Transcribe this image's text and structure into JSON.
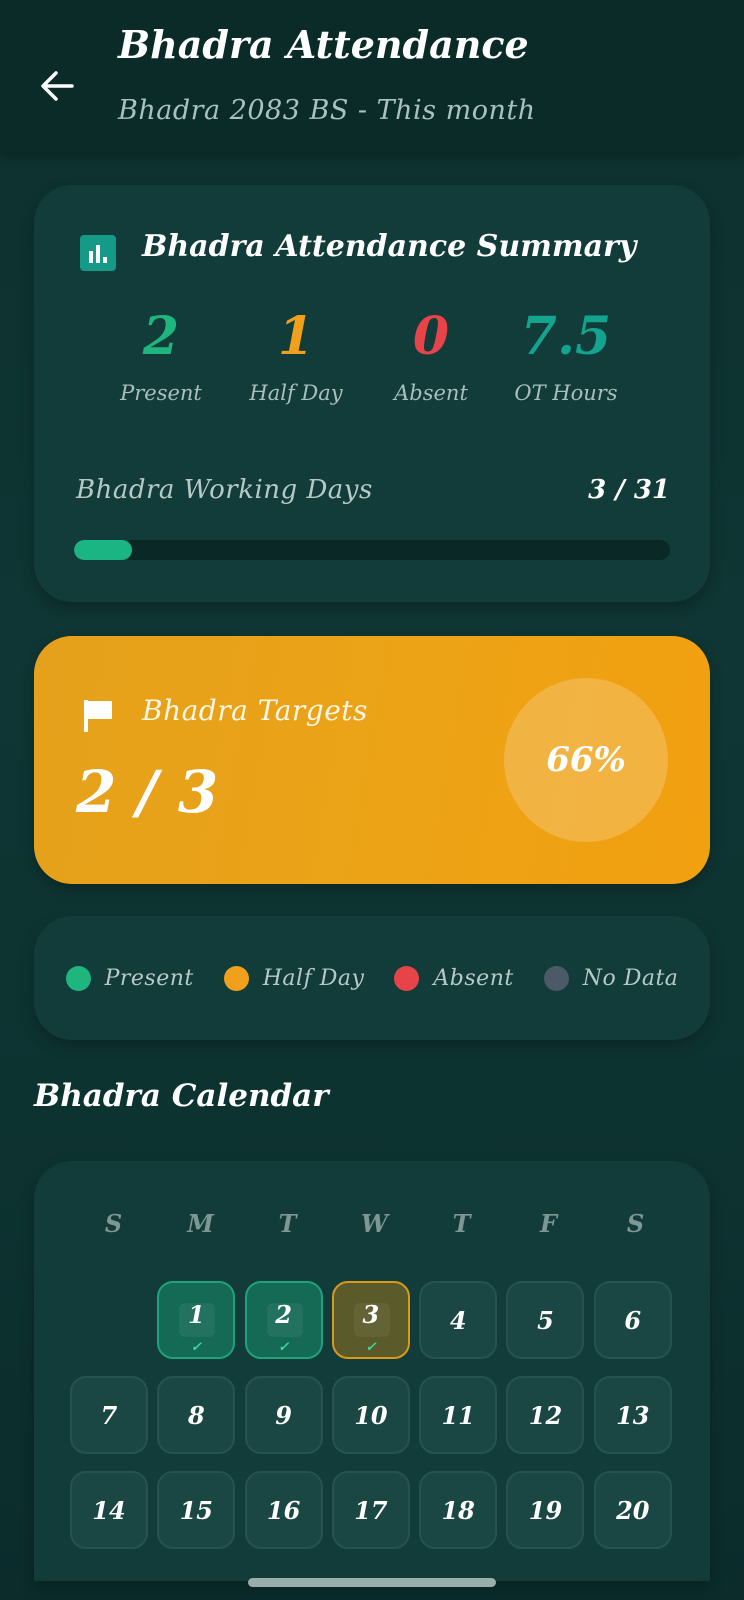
{
  "header": {
    "title": "Bhadra Attendance",
    "subtitle": "Bhadra 2083 BS - This month"
  },
  "summary": {
    "title": "Bhadra Attendance Summary",
    "stats": [
      {
        "value": "2",
        "label": "Present",
        "color": "#1fb57f"
      },
      {
        "value": "1",
        "label": "Half Day",
        "color": "#f0a01a"
      },
      {
        "value": "0",
        "label": "Absent",
        "color": "#e9434a"
      },
      {
        "value": "7.5",
        "label": "OT Hours",
        "color": "#14a38f"
      }
    ],
    "working_days_label": "Bhadra Working Days",
    "working_days_value": "3 / 31",
    "progress_fraction": 0.0968
  },
  "targets": {
    "title": "Bhadra Targets",
    "value": "2 / 3",
    "percent": "66%"
  },
  "legend": [
    {
      "label": "Present",
      "color": "#1fb57f"
    },
    {
      "label": "Half Day",
      "color": "#f0a01a"
    },
    {
      "label": "Absent",
      "color": "#e9434a"
    },
    {
      "label": "No Data",
      "color": "#4b5a66"
    }
  ],
  "calendar": {
    "title": "Bhadra Calendar",
    "weekdays": [
      "S",
      "M",
      "T",
      "W",
      "T",
      "F",
      "S"
    ],
    "days": [
      {
        "n": "",
        "status": "empty"
      },
      {
        "n": "1",
        "status": "present"
      },
      {
        "n": "2",
        "status": "present"
      },
      {
        "n": "3",
        "status": "half"
      },
      {
        "n": "4",
        "status": "none"
      },
      {
        "n": "5",
        "status": "none"
      },
      {
        "n": "6",
        "status": "none"
      },
      {
        "n": "7",
        "status": "none"
      },
      {
        "n": "8",
        "status": "none"
      },
      {
        "n": "9",
        "status": "none"
      },
      {
        "n": "10",
        "status": "none"
      },
      {
        "n": "11",
        "status": "none"
      },
      {
        "n": "12",
        "status": "none"
      },
      {
        "n": "13",
        "status": "none"
      },
      {
        "n": "14",
        "status": "none"
      },
      {
        "n": "15",
        "status": "none"
      },
      {
        "n": "16",
        "status": "none"
      },
      {
        "n": "17",
        "status": "none"
      },
      {
        "n": "18",
        "status": "none"
      },
      {
        "n": "19",
        "status": "none"
      },
      {
        "n": "20",
        "status": "none"
      }
    ]
  }
}
